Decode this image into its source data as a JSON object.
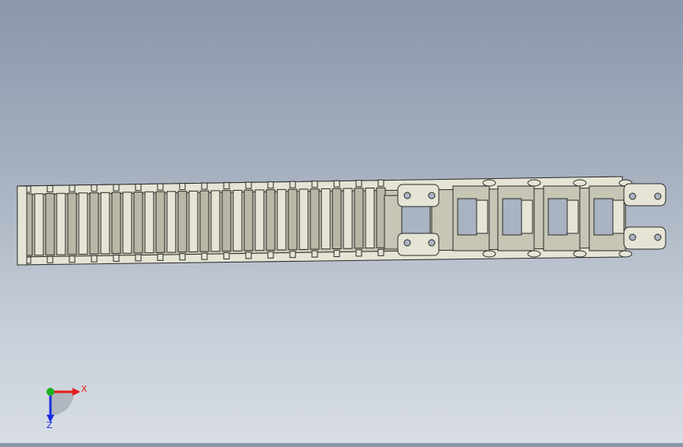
{
  "viewport": {
    "model": "cable-drag-chain",
    "background": [
      "#8a97ab",
      "#d8dde4"
    ]
  },
  "triad": {
    "x_label": "X",
    "z_label": "Z",
    "x_color": "#e31b1b",
    "y_color": "#19b219",
    "z_color": "#1b2ee3"
  },
  "colors": {
    "chain_body": "#c7c5b4",
    "chain_light": "#e6e4d4",
    "chain_edge": "#2a2a2a",
    "hole_fill": "#a9b3c2"
  }
}
